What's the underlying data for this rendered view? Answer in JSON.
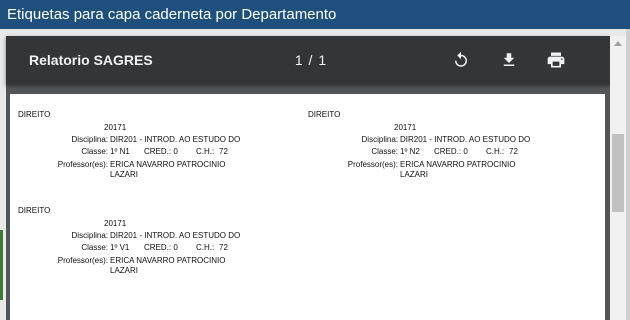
{
  "window": {
    "title": "Etiquetas para capa caderneta por Departamento"
  },
  "viewer": {
    "title": "Relatorio SAGRES",
    "page_indicator": "1 / 1",
    "icons": [
      "rotate-icon",
      "download-icon",
      "print-icon"
    ]
  },
  "colors": {
    "title_bar": "#1e4f7d",
    "viewer_bg": "#525659",
    "toolbar": "#323639",
    "accent_left": "#3d7a3a"
  },
  "labels": [
    {
      "department": "DIREITO",
      "semester": "20171",
      "disciplina_label": "Disciplina:",
      "disciplina_value": "DIR201 - INTROD. AO ESTUDO DO D",
      "classe_label": "Classe:",
      "classe_value": "1º N1",
      "cred_label": "CRED.: 0",
      "ch_label": "C.H.:",
      "ch_value": "72",
      "professor_label": "Professor(es):",
      "professor_line1": "ERICA NAVARRO PATROCINIO",
      "professor_line2": "LAZARI"
    },
    {
      "department": "DIREITO",
      "semester": "20171",
      "disciplina_label": "Disciplina:",
      "disciplina_value": "DIR201 - INTROD. AO ESTUDO DO D",
      "classe_label": "Classe:",
      "classe_value": "1º N2",
      "cred_label": "CRED.: 0",
      "ch_label": "C.H.:",
      "ch_value": "72",
      "professor_label": "Professor(es):",
      "professor_line1": "ERICA NAVARRO PATROCINIO",
      "professor_line2": "LAZARI"
    },
    {
      "department": "DIREITO",
      "semester": "20171",
      "disciplina_label": "Disciplina:",
      "disciplina_value": "DIR201 - INTROD. AO ESTUDO DO D",
      "classe_label": "Classe:",
      "classe_value": "1º V1",
      "cred_label": "CRED.: 0",
      "ch_label": "C.H.:",
      "ch_value": "72",
      "professor_label": "Professor(es):",
      "professor_line1": "ERICA NAVARRO PATROCINIO",
      "professor_line2": "LAZARI"
    }
  ]
}
